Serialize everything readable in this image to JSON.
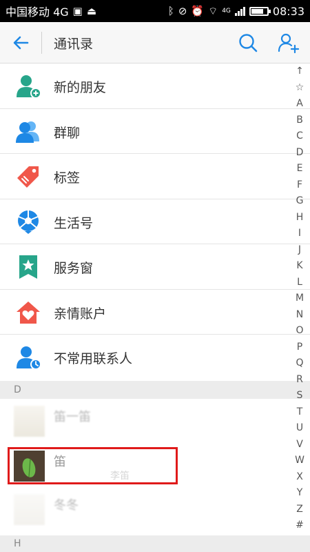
{
  "status_bar": {
    "carrier": "中国移动 4G",
    "network_badge": "4G",
    "time": "08:33"
  },
  "header": {
    "title": "通讯录",
    "back_icon": "back-arrow-icon",
    "search_icon": "search-icon",
    "add_icon": "add-friend-icon",
    "accent": "#1e88e5"
  },
  "menu": [
    {
      "label": "新的朋友",
      "icon": "new-friend-icon",
      "color": "#27a58a"
    },
    {
      "label": "群聊",
      "icon": "group-chat-icon",
      "color": "#1e88e5"
    },
    {
      "label": "标签",
      "icon": "tag-icon",
      "color": "#f0574a"
    },
    {
      "label": "生活号",
      "icon": "life-account-icon",
      "color": "#1e88e5"
    },
    {
      "label": "服务窗",
      "icon": "service-window-icon",
      "color": "#27a58a"
    },
    {
      "label": "亲情账户",
      "icon": "family-account-icon",
      "color": "#f0574a"
    },
    {
      "label": "不常用联系人",
      "icon": "infrequent-contacts-icon",
      "color": "#1e88e5"
    }
  ],
  "sections": {
    "d": "D",
    "h": "H"
  },
  "contacts": {
    "first": {
      "name": "笛一笛",
      "sub": ""
    },
    "highlighted": {
      "name": "笛",
      "sub": "李笛"
    },
    "third": {
      "name": "冬冬",
      "sub": ""
    }
  },
  "index_bar": [
    "↑",
    "☆",
    "A",
    "B",
    "C",
    "D",
    "E",
    "F",
    "G",
    "H",
    "I",
    "J",
    "K",
    "L",
    "M",
    "N",
    "O",
    "P",
    "Q",
    "R",
    "S",
    "T",
    "U",
    "V",
    "W",
    "X",
    "Y",
    "Z",
    "#"
  ]
}
